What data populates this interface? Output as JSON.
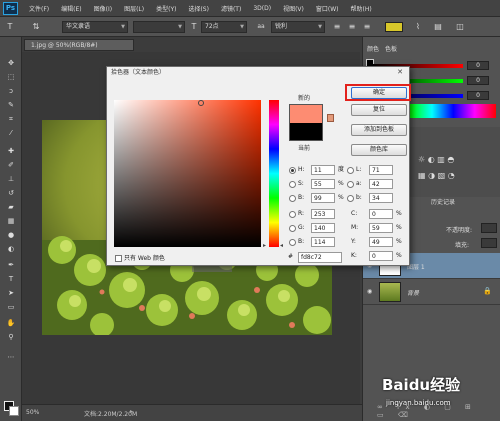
{
  "app": {
    "logo": "Ps"
  },
  "menu": [
    "文件(F)",
    "编辑(E)",
    "图像(I)",
    "图层(L)",
    "类型(Y)",
    "选择(S)",
    "滤镜(T)",
    "3D(D)",
    "视图(V)",
    "窗口(W)",
    "帮助(H)"
  ],
  "options": {
    "font_family": "华文隶语",
    "font_size": "72点",
    "antialias": "锐利"
  },
  "document": {
    "tab_title": "1.jpg @ 50%(RGB/8#)",
    "zoom": "50%",
    "doc_info": "文档:2.20M/2.20M"
  },
  "panels": {
    "color_tab": "颜色",
    "swatches_tab": "色板",
    "slider_values": [
      "0",
      "0",
      "0"
    ],
    "history_tab": "历史记录",
    "opacity_label": "不透明度:",
    "fill_label": "填充:",
    "layers": [
      {
        "name": "图层 1"
      },
      {
        "name": "背景"
      }
    ]
  },
  "dialog": {
    "title": "拾色器（文本颜色）",
    "close": "✕",
    "new_label": "新的",
    "current_label": "当前",
    "buttons": {
      "ok": "确定",
      "reset": "复位",
      "add_swatch": "添加到色板",
      "color_libraries": "颜色库"
    },
    "fields": {
      "H": {
        "label": "H:",
        "value": "11",
        "unit": "度"
      },
      "S": {
        "label": "S:",
        "value": "55",
        "unit": "%"
      },
      "B": {
        "label": "B:",
        "value": "99",
        "unit": "%"
      },
      "R": {
        "label": "R:",
        "value": "253"
      },
      "G": {
        "label": "G:",
        "value": "140"
      },
      "Bl": {
        "label": "B:",
        "value": "114"
      },
      "L": {
        "label": "L:",
        "value": "71"
      },
      "a": {
        "label": "a:",
        "value": "42"
      },
      "b": {
        "label": "b:",
        "value": "34"
      },
      "C": {
        "label": "C:",
        "value": "0",
        "unit": "%"
      },
      "M": {
        "label": "M:",
        "value": "59",
        "unit": "%"
      },
      "Y": {
        "label": "Y:",
        "value": "49",
        "unit": "%"
      },
      "K": {
        "label": "K:",
        "value": "0",
        "unit": "%"
      }
    },
    "hex_label": "#",
    "hex_value": "fd8c72",
    "web_only": "只有 Web 颜色",
    "new_color": "#fd8c72",
    "current_color": "#000000"
  },
  "watermark": {
    "brand": "Baidu经验",
    "url": "jingyan.baidu.com"
  }
}
